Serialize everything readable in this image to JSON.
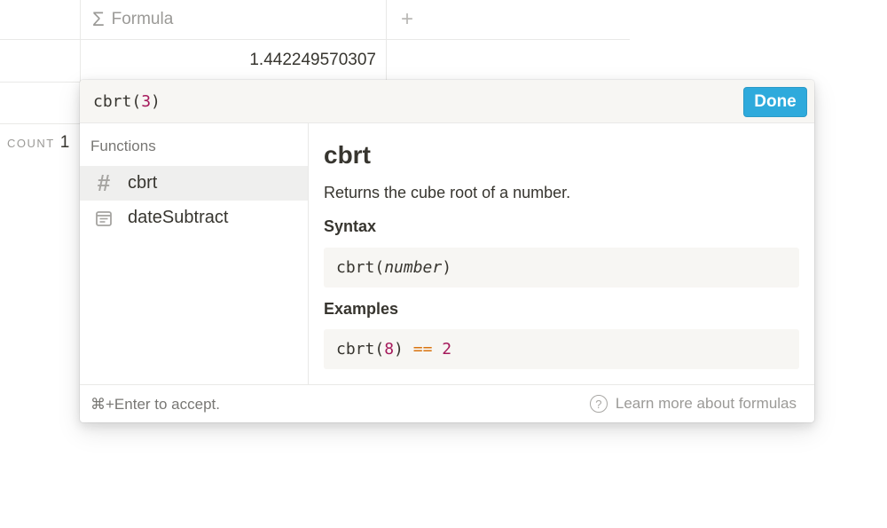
{
  "table": {
    "column_header": "Formula",
    "column_icon": "sigma-icon",
    "add_column_icon": "plus-icon",
    "cell_value": "1.442249570307",
    "count_label": "COUNT",
    "count_value": "1"
  },
  "editor": {
    "fn": "cbrt",
    "open": "(",
    "arg": "3",
    "close": ")",
    "done_label": "Done"
  },
  "functions": {
    "label": "Functions",
    "items": [
      {
        "label": "cbrt",
        "icon": "hash-icon",
        "selected": true
      },
      {
        "label": "dateSubtract",
        "icon": "calendar-icon",
        "selected": false
      }
    ]
  },
  "detail": {
    "title": "cbrt",
    "description": "Returns the cube root of a number.",
    "syntax_heading": "Syntax",
    "syntax": {
      "fn": "cbrt",
      "open": "(",
      "param": "number",
      "close": ")"
    },
    "examples_heading": "Examples",
    "example": {
      "fn": "cbrt",
      "open": "(",
      "arg": "8",
      "close": ")",
      "op": "==",
      "result": "2"
    }
  },
  "footer": {
    "hint_keys": "⌘+Enter",
    "hint_text": " to accept.",
    "learn_more": "Learn more about formulas",
    "help_icon": "question-circle-icon"
  },
  "colors": {
    "accent": "#2eaadc",
    "number_token": "#a5195b",
    "operator_token": "#d9730d",
    "text": "#37352f",
    "muted": "#9b9a97"
  }
}
